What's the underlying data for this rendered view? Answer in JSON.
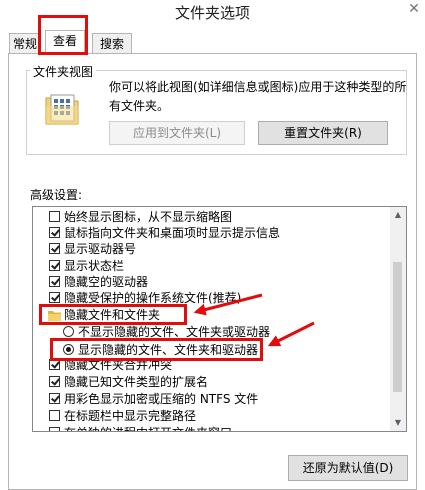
{
  "window": {
    "title": "文件夹选项",
    "close_glyph": "✕"
  },
  "tabs": [
    {
      "label": "常规"
    },
    {
      "label": "查看"
    },
    {
      "label": "搜索"
    }
  ],
  "folder_views": {
    "title": "文件夹视图",
    "description": "你可以将此视图(如详细信息或图标)应用于这种类型的所有文件夹。",
    "apply_button": "应用到文件夹(L)",
    "reset_button": "重置文件夹(R)"
  },
  "advanced": {
    "label": "高级设置:",
    "items": [
      {
        "kind": "checkbox",
        "checked": false,
        "text": "始终显示图标，从不显示缩略图"
      },
      {
        "kind": "checkbox",
        "checked": true,
        "text": "鼠标指向文件夹和桌面项时显示提示信息"
      },
      {
        "kind": "checkbox",
        "checked": true,
        "text": "显示驱动器号"
      },
      {
        "kind": "checkbox",
        "checked": true,
        "text": "显示状态栏"
      },
      {
        "kind": "checkbox",
        "checked": true,
        "text": "隐藏空的驱动器"
      },
      {
        "kind": "checkbox",
        "checked": true,
        "text": "隐藏受保护的操作系统文件(推荐)"
      },
      {
        "kind": "folder",
        "text": "隐藏文件和文件夹"
      },
      {
        "kind": "radio",
        "checked": false,
        "text": "不显示隐藏的文件、文件夹或驱动器"
      },
      {
        "kind": "radio",
        "checked": true,
        "text": "显示隐藏的文件、文件夹和驱动器"
      },
      {
        "kind": "checkbox",
        "checked": true,
        "text": "隐藏文件夹合并冲突"
      },
      {
        "kind": "checkbox",
        "checked": true,
        "text": "隐藏已知文件类型的扩展名"
      },
      {
        "kind": "checkbox",
        "checked": true,
        "text": "用彩色显示加密或压缩的 NTFS 文件"
      },
      {
        "kind": "checkbox",
        "checked": false,
        "text": "在标题栏中显示完整路径"
      },
      {
        "kind": "checkbox",
        "checked": false,
        "text": "在单独的进程中打开文件夹窗口"
      }
    ],
    "restore_button": "还原为默认值(D)"
  },
  "colors": {
    "annotation_red": "#e10d0d"
  }
}
